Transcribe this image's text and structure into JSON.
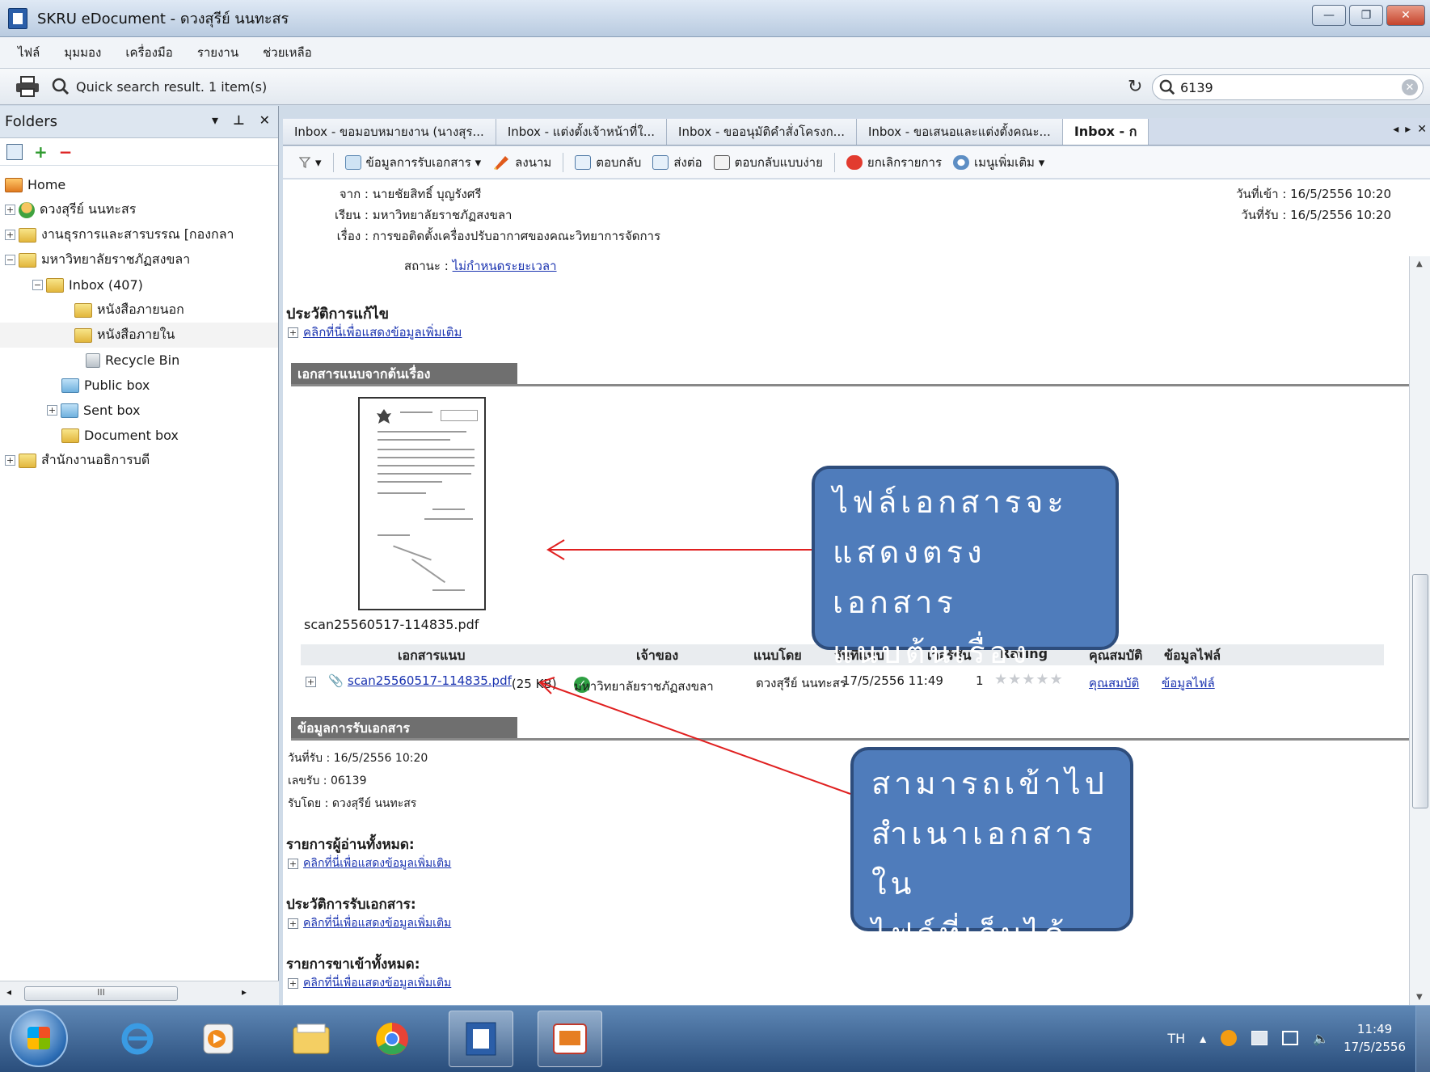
{
  "window": {
    "title": "SKRU eDocument - ดวงสุรีย์ นนทะสร",
    "ctrl_min": "—",
    "ctrl_max": "❐",
    "ctrl_close": "✕"
  },
  "menu": [
    "ไฟล์",
    "มุมมอง",
    "เครื่องมือ",
    "รายงาน",
    "ช่วยเหลือ"
  ],
  "search": {
    "result_label": "Quick search result. 1 item(s)",
    "query": "6139",
    "clear": "✕",
    "refresh": "↻"
  },
  "folders": {
    "title": "Folders",
    "ctrls": [
      "▾",
      "⊥",
      "✕"
    ],
    "tree": [
      {
        "label": "Home",
        "exp": ""
      },
      {
        "label": "ดวงสุรีย์ นนทะสร",
        "exp": "+"
      },
      {
        "label": "งานธุรการและสารบรรณ [กองกลา",
        "exp": "+"
      },
      {
        "label": "มหาวิทยาลัยราชภัฏสงขลา",
        "exp": "−"
      },
      {
        "label": "Inbox (407)",
        "exp": "−"
      },
      {
        "label": "หนังสือภายนอก",
        "exp": ""
      },
      {
        "label": "หนังสือภายใน",
        "exp": ""
      },
      {
        "label": "Recycle Bin",
        "exp": ""
      },
      {
        "label": "Public box",
        "exp": ""
      },
      {
        "label": "Sent box",
        "exp": "+"
      },
      {
        "label": "Document box",
        "exp": ""
      },
      {
        "label": "สำนักงานอธิการบดี",
        "exp": "+"
      }
    ],
    "scroll_thumb": "III"
  },
  "tabs": [
    "Inbox - ขอมอบหมายงาน (นางสุร...",
    "Inbox - แต่งตั้งเจ้าหน้าที่ใ...",
    "Inbox - ขออนุมัติคำสั่งโครงก...",
    "Inbox - ขอเสนอและแต่งตั้งคณะ...",
    "Inbox - ก"
  ],
  "tab_nav": [
    "◂",
    "▸",
    "✕"
  ],
  "toolbar": {
    "filter": "▾",
    "receive_info": "ข้อมูลการรับเอกสาร ▾",
    "sign": "ลงนาม",
    "reply": "ตอบกลับ",
    "forward": "ส่งต่อ",
    "simple_reply": "ตอบกลับแบบง่าย",
    "cancel": "ยกเลิกรายการ",
    "more": "เมนูเพิ่มเติม ▾"
  },
  "doc": {
    "from_label": "จาก :",
    "from": "นายชัยสิทธิ์ บุญรังศรี",
    "to_label": "เรียน :",
    "to": "มหาวิทยาลัยราชภัฏสงขลา",
    "subject_label": "เรื่อง :",
    "subject": "การขอติดตั้งเครื่องปรับอากาศของคณะวิทยาการจัดการ",
    "date_in": "วันที่เข้า : 16/5/2556 10:20",
    "date_recv": "วันที่รับ : 16/5/2556 10:20",
    "status_label": "สถานะ :",
    "status": "ไม่กำหนดระยะเวลา"
  },
  "history": {
    "title": "ประวัติการแก้ไข",
    "link": "คลิกที่นี่เพื่อแสดงข้อมูลเพิ่มเติม"
  },
  "attachments_section": {
    "title": "เอกสารแนบจากต้นเรื่อง",
    "thumb_caption": "scan25560517-114835.pdf"
  },
  "attachment_table": {
    "headers": [
      "เอกสารแนบ",
      "เจ้าของ",
      "แนบโดย",
      "วันที่แนบ",
      "เวอร์ชัน",
      "Rating",
      "คุณสมบัติ",
      "ข้อมูลไฟล์"
    ],
    "row": {
      "file": "scan25560517-114835.pdf",
      "size": "(25 KB)",
      "owner": "มหาวิทยาลัยราชภัฏสงขลา",
      "by": "ดวงสุรีย์ นนทะสร",
      "date": "17/5/2556 11:49",
      "version": "1",
      "rating_stars": "★★★★★",
      "rating_value": 0,
      "props": "คุณสมบัติ",
      "fileinfo": "ข้อมูลไฟล์"
    }
  },
  "receive": {
    "title": "ข้อมูลการรับเอกสาร",
    "date": "วันที่รับ : 16/5/2556 10:20",
    "number": "เลขรับ : 06139",
    "by": "รับโดย : ดวงสุรีย์ นนทะสร"
  },
  "readers": {
    "title": "รายการผู้อ่านทั้งหมด:",
    "link": "คลิกที่นี่เพื่อแสดงข้อมูลเพิ่มเติม"
  },
  "recv_history": {
    "title": "ประวัติการรับเอกสาร:",
    "link": "คลิกที่นี่เพื่อแสดงข้อมูลเพิ่มเติม"
  },
  "all_in": {
    "title": "รายการขาเข้าทั้งหมด:",
    "link": "คลิกที่นี่เพื่อแสดงข้อมูลเพิ่มเติม"
  },
  "callouts": {
    "one": [
      "ไฟล์เอกสารจะ",
      "แสดงตรงเอกสาร",
      "แนบต้นเรื่อง"
    ],
    "two": [
      "สามารถเข้าไป",
      "สำเนาเอกสารใน",
      "ไฟล์ที่เก็บได้"
    ]
  },
  "taskbar": {
    "lang": "TH",
    "time": "11:49",
    "date": "17/5/2556",
    "tray_up": "▴"
  },
  "colors": {
    "callout": "#4f7cbb",
    "arrow": "#e02020",
    "section_bar": "#6f6f6f",
    "taskbar": "#3b618f"
  }
}
